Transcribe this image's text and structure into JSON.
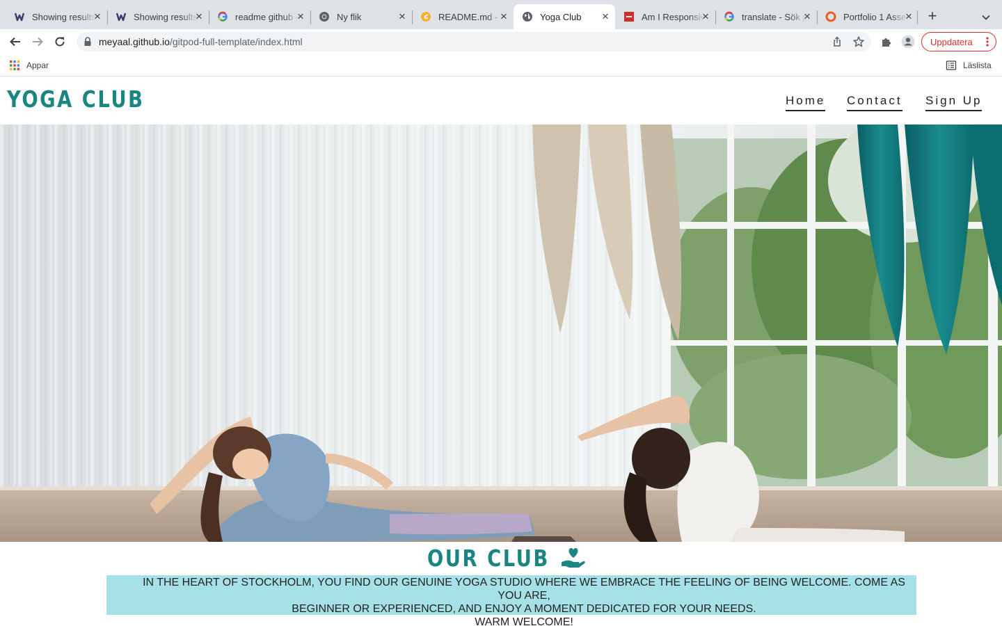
{
  "browser": {
    "tabs": [
      {
        "title": "Showing results for readme",
        "favicon": "showing-results-icon"
      },
      {
        "title": "Showing results for readme",
        "favicon": "showing-results-icon"
      },
      {
        "title": "readme github - Google Search",
        "favicon": "google-icon"
      },
      {
        "title": "Ny flik",
        "favicon": "chrome-icon"
      },
      {
        "title": "README.md - Gitpod",
        "favicon": "gitpod-icon"
      },
      {
        "title": "Yoga Club",
        "favicon": "globe-icon",
        "active": true
      },
      {
        "title": "Am I Responsive?",
        "favicon": "amiresponsive-icon"
      },
      {
        "title": "translate - Sök på Google",
        "favicon": "google-icon"
      },
      {
        "title": "Portfolio 1 Assessment",
        "favicon": "portfolio-icon"
      }
    ],
    "url_host": "meyaal.github.io",
    "url_path": "/gitpod-full-template/index.html",
    "update_label": "Uppdatera",
    "bookmarks": {
      "apps_label": "Appar",
      "reading_list_label": "Läslista"
    },
    "colors": {
      "update_accent": "#d93025",
      "tabstrip": "#dee1e6"
    }
  },
  "site": {
    "logo": "YOGA CLUB",
    "nav": [
      {
        "label": "Home"
      },
      {
        "label": "Contact"
      },
      {
        "label": "Sign Up"
      }
    ],
    "hero": {
      "image": "hero-yoga-studio-photo"
    },
    "club": {
      "title": "OUR CLUB",
      "icon": "hand-holding-heart-icon",
      "line1": "IN THE HEART OF STOCKHOLM, YOU FIND OUR GENUINE YOGA STUDIO WHERE WE EMBRACE THE FEELING OF BEING WELCOME. COME AS YOU ARE,",
      "line2": "BEGINNER OR EXPERIENCED, AND ENJOY A MOMENT DEDICATED FOR YOUR NEEDS.",
      "line3": "WARM WELCOME!"
    },
    "colors": {
      "brand": "#1b8581",
      "intro_bg": "#a6e1e8"
    }
  }
}
